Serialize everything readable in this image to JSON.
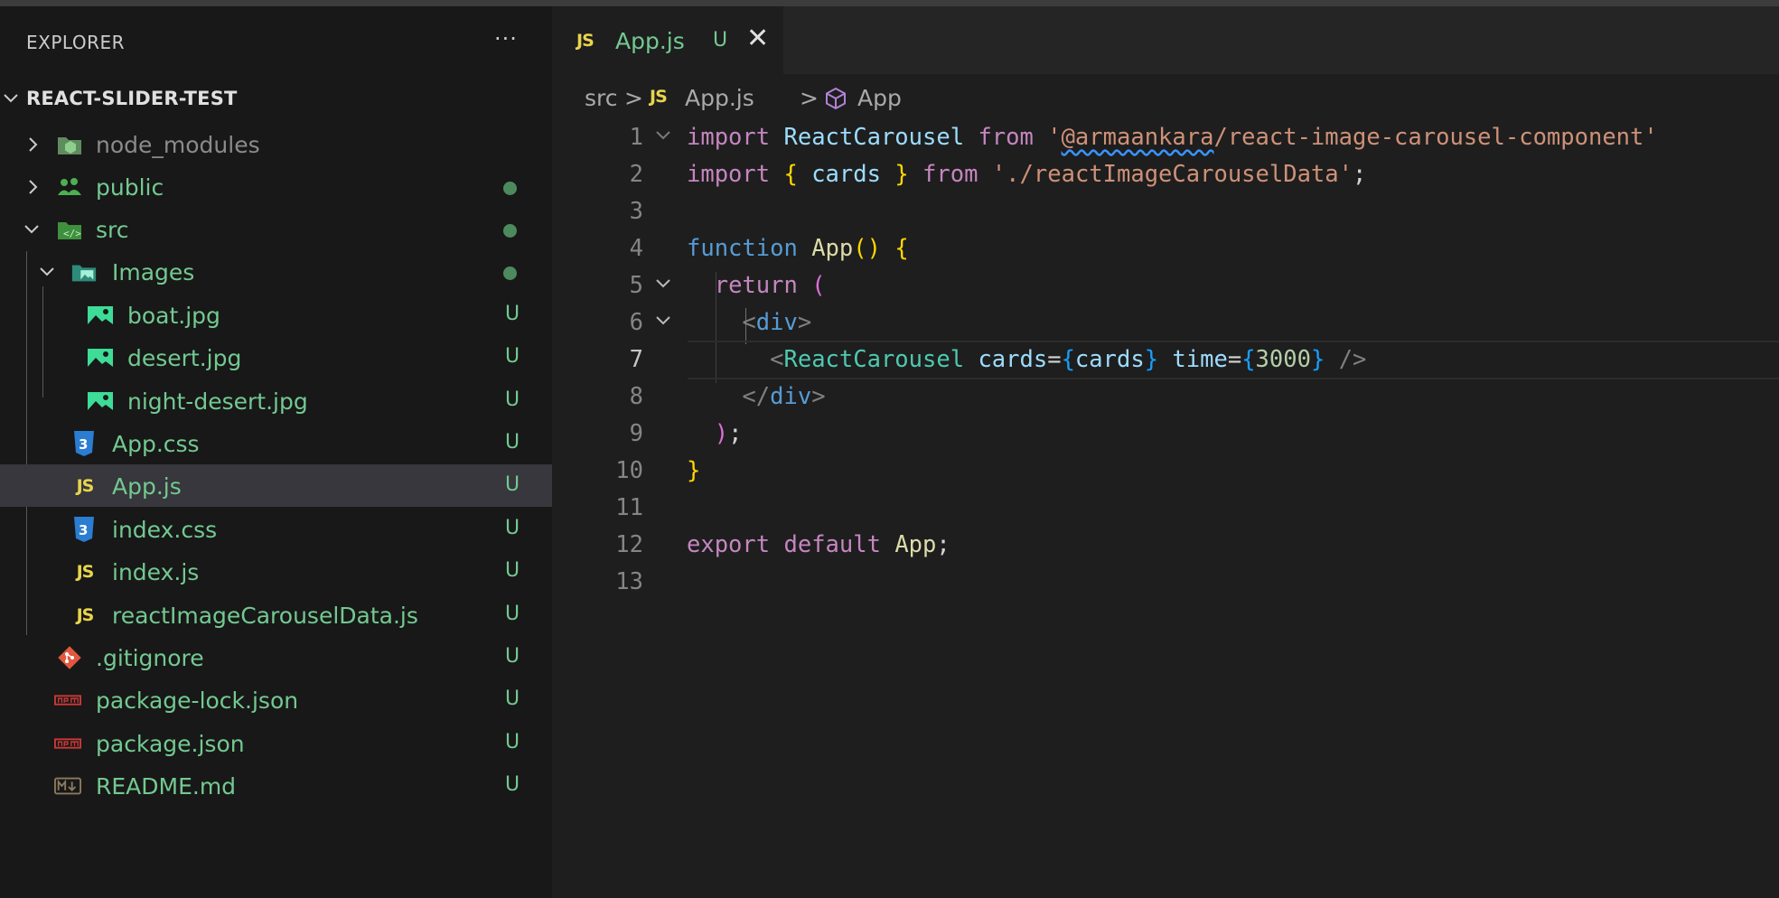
{
  "sidebar": {
    "title": "EXPLORER",
    "more": "···",
    "root": "REACT-SLIDER-TEST",
    "items": [
      {
        "label": "node_modules",
        "icon": "node-folder-icon",
        "status": ""
      },
      {
        "label": "public",
        "icon": "public-folder-icon",
        "status": "dot"
      },
      {
        "label": "src",
        "icon": "src-folder-icon",
        "status": "dot"
      },
      {
        "label": "Images",
        "icon": "images-folder-icon",
        "status": "dot"
      },
      {
        "label": "boat.jpg",
        "icon": "image-file-icon",
        "status": "U"
      },
      {
        "label": "desert.jpg",
        "icon": "image-file-icon",
        "status": "U"
      },
      {
        "label": "night-desert.jpg",
        "icon": "image-file-icon",
        "status": "U"
      },
      {
        "label": "App.css",
        "icon": "css-file-icon",
        "status": "U"
      },
      {
        "label": "App.js",
        "icon": "js-file-icon",
        "status": "U"
      },
      {
        "label": "index.css",
        "icon": "css-file-icon",
        "status": "U"
      },
      {
        "label": "index.js",
        "icon": "js-file-icon",
        "status": "U"
      },
      {
        "label": "reactImageCarouselData.js",
        "icon": "js-file-icon",
        "status": "U"
      },
      {
        "label": ".gitignore",
        "icon": "git-file-icon",
        "status": "U"
      },
      {
        "label": "package-lock.json",
        "icon": "npm-file-icon",
        "status": "U"
      },
      {
        "label": "package.json",
        "icon": "npm-file-icon",
        "status": "U"
      },
      {
        "label": "README.md",
        "icon": "markdown-file-icon",
        "status": "U"
      }
    ]
  },
  "editor": {
    "tab": {
      "badge": "JS",
      "name": "App.js",
      "status": "U",
      "close": "✕"
    },
    "breadcrumbs": {
      "folder": "src",
      "file_badge": "JS",
      "file": "App.js",
      "symbol": "App",
      "sep": ">"
    },
    "line_numbers": [
      "1",
      "2",
      "3",
      "4",
      "5",
      "6",
      "7",
      "8",
      "9",
      "10",
      "11",
      "12",
      "13"
    ],
    "code": {
      "l1": {
        "kw": "import",
        "name": "ReactCarousel",
        "from": "from",
        "q1": "'",
        "scope": "@armaankara",
        "path": "/react-image-carousel-component",
        "q2": "'"
      },
      "l2": {
        "kw": "import",
        "ob": "{",
        "name": "cards",
        "cb": "}",
        "from": "from",
        "str": "'./reactImageCarouselData'",
        "semi": ";"
      },
      "l4": {
        "kw": "function",
        "name": "App",
        "paren": "()",
        "brace": "{"
      },
      "l5": {
        "kw": "return",
        "paren": "("
      },
      "l6": {
        "lt": "<",
        "tag": "div",
        "gt": ">"
      },
      "l7": {
        "lt": "<",
        "tag": "ReactCarousel",
        "attr1": "cards",
        "eq1": "=",
        "ob1": "{",
        "val1": "cards",
        "cb1": "}",
        "attr2": "time",
        "eq2": "=",
        "ob2": "{",
        "val2": "3000",
        "cb2": "}",
        "close": "/>"
      },
      "l8": {
        "lt": "</",
        "tag": "div",
        "gt": ">"
      },
      "l9": {
        "paren": ")",
        "semi": ";"
      },
      "l10": {
        "brace": "}"
      },
      "l12": {
        "kw1": "export",
        "kw2": "default",
        "name": "App",
        "semi": ";"
      }
    }
  },
  "colors": {
    "untracked": "#73c991",
    "accent_js": "#e8d44d",
    "selection": "#37373d"
  }
}
